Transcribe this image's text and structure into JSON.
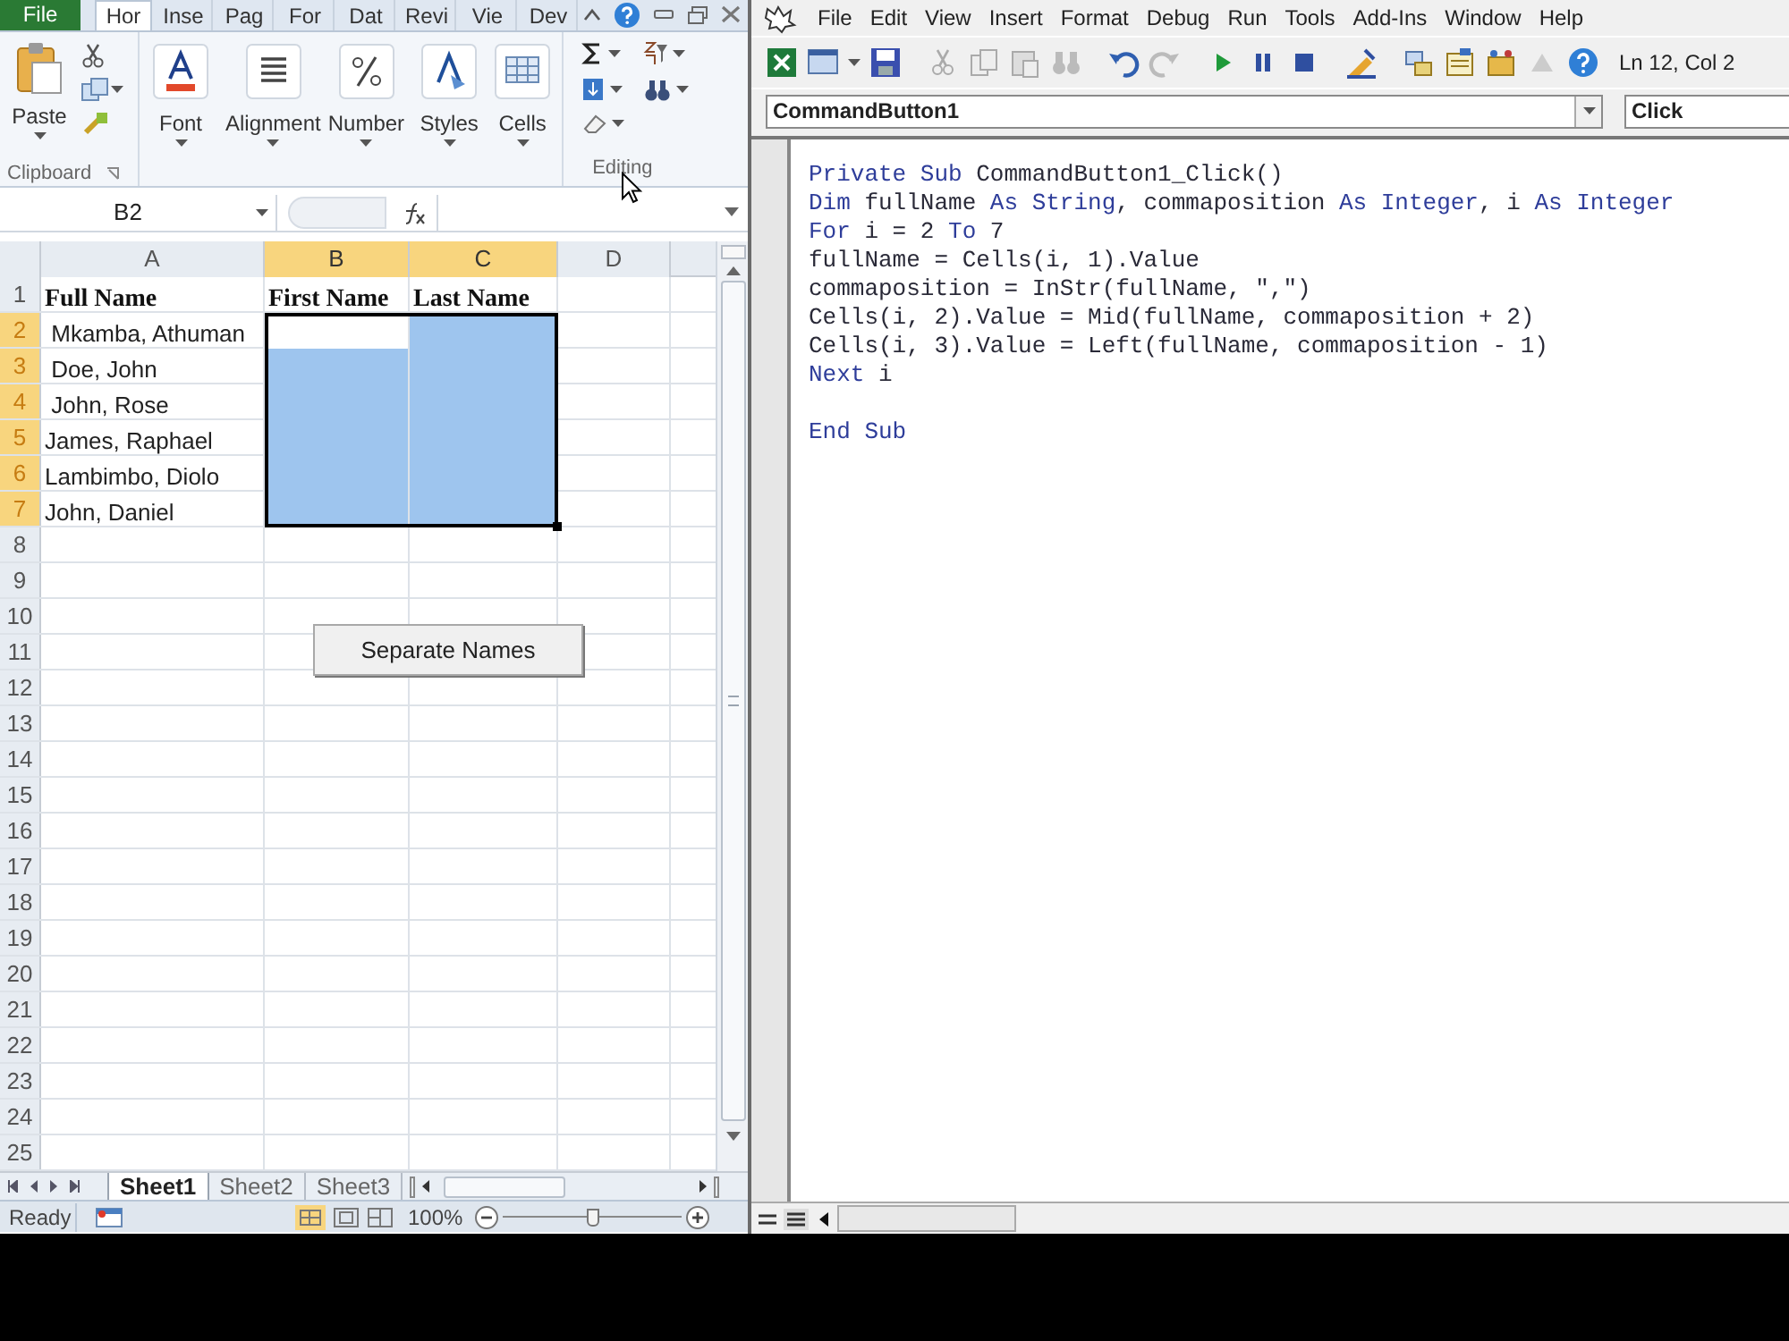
{
  "excel": {
    "file_tab": "File",
    "ribbon_tabs": [
      {
        "label": "Hor",
        "selected": true
      },
      {
        "label": "Inse",
        "selected": false
      },
      {
        "label": "Pag",
        "selected": false
      },
      {
        "label": "For",
        "selected": false
      },
      {
        "label": "Dat",
        "selected": false
      },
      {
        "label": "Revi",
        "selected": false
      },
      {
        "label": "Vie",
        "selected": false
      },
      {
        "label": "Dev",
        "selected": false
      }
    ],
    "ribbon": {
      "paste": "Paste",
      "clipboard_group": "Clipboard",
      "commands": [
        "Font",
        "Alignment",
        "Number",
        "Styles",
        "Cells"
      ],
      "editing_group": "Editing"
    },
    "name_box": "B2",
    "columns": [
      {
        "label": "A",
        "selected": false
      },
      {
        "label": "B",
        "selected": true
      },
      {
        "label": "C",
        "selected": true
      },
      {
        "label": "D",
        "selected": false
      }
    ],
    "header_row": {
      "number": "1",
      "cells": [
        "Full Name",
        "First Name",
        "Last Name"
      ]
    },
    "rows": [
      {
        "number": "2",
        "selected": true,
        "active": true,
        "full_name": " Mkamba, Athuman"
      },
      {
        "number": "3",
        "selected": true,
        "active": false,
        "full_name": " Doe, John"
      },
      {
        "number": "4",
        "selected": true,
        "active": false,
        "full_name": " John, Rose"
      },
      {
        "number": "5",
        "selected": true,
        "active": false,
        "full_name": "James, Raphael"
      },
      {
        "number": "6",
        "selected": true,
        "active": false,
        "full_name": "Lambimbo, Diolo"
      },
      {
        "number": "7",
        "selected": true,
        "active": false,
        "full_name": "John, Daniel"
      },
      {
        "number": "8",
        "selected": false
      },
      {
        "number": "9",
        "selected": false
      },
      {
        "number": "10",
        "selected": false
      },
      {
        "number": "11",
        "selected": false
      },
      {
        "number": "12",
        "selected": false
      },
      {
        "number": "13",
        "selected": false
      },
      {
        "number": "14",
        "selected": false
      },
      {
        "number": "15",
        "selected": false
      },
      {
        "number": "16",
        "selected": false
      },
      {
        "number": "17",
        "selected": false
      },
      {
        "number": "18",
        "selected": false
      },
      {
        "number": "19",
        "selected": false
      },
      {
        "number": "20",
        "selected": false
      },
      {
        "number": "21",
        "selected": false
      },
      {
        "number": "22",
        "selected": false
      },
      {
        "number": "23",
        "selected": false
      },
      {
        "number": "24",
        "selected": false
      },
      {
        "number": "25",
        "selected": false
      }
    ],
    "button": "Separate Names",
    "sheet_tabs": [
      {
        "label": "Sheet1",
        "selected": true
      },
      {
        "label": "Sheet2",
        "selected": false
      },
      {
        "label": "Sheet3",
        "selected": false
      }
    ],
    "status": "Ready",
    "zoom": "100%",
    "zoom_slider": {
      "level": 0.5
    }
  },
  "vba": {
    "menu": [
      "File",
      "Edit",
      "View",
      "Insert",
      "Format",
      "Debug",
      "Run",
      "Tools",
      "Add-Ins",
      "Window",
      "Help"
    ],
    "cursor_position": "Ln 12, Col 2",
    "object_box": "CommandButton1",
    "procedure_box": "Click",
    "code": [
      {
        "kind": "code",
        "segments": [
          {
            "kind": "keyword",
            "text": "Private Sub"
          },
          {
            "kind": "plain",
            "text": " CommandButton1_Click()"
          }
        ]
      },
      {
        "kind": "code",
        "segments": [
          {
            "kind": "keyword",
            "text": "Dim"
          },
          {
            "kind": "plain",
            "text": " fullName "
          },
          {
            "kind": "keyword",
            "text": "As String"
          },
          {
            "kind": "plain",
            "text": ", commaposition "
          },
          {
            "kind": "keyword",
            "text": "As Integer"
          },
          {
            "kind": "plain",
            "text": ", i "
          },
          {
            "kind": "keyword",
            "text": "As Integer"
          }
        ]
      },
      {
        "kind": "code",
        "segments": [
          {
            "kind": "keyword",
            "text": "For"
          },
          {
            "kind": "plain",
            "text": " i = 2 "
          },
          {
            "kind": "keyword",
            "text": "To"
          },
          {
            "kind": "plain",
            "text": " 7"
          }
        ]
      },
      {
        "kind": "code",
        "segments": [
          {
            "kind": "plain",
            "text": "fullName = Cells(i, 1).Value"
          }
        ]
      },
      {
        "kind": "code",
        "segments": [
          {
            "kind": "plain",
            "text": "commaposition = InStr(fullName, \",\")"
          }
        ]
      },
      {
        "kind": "code",
        "segments": [
          {
            "kind": "plain",
            "text": "Cells(i, 2).Value = Mid(fullName, commaposition + 2)"
          }
        ]
      },
      {
        "kind": "code",
        "segments": [
          {
            "kind": "plain",
            "text": "Cells(i, 3).Value = Left(fullName, commaposition - 1)"
          }
        ]
      },
      {
        "kind": "code",
        "segments": [
          {
            "kind": "keyword",
            "text": "Next"
          },
          {
            "kind": "plain",
            "text": " i"
          }
        ]
      },
      {
        "kind": "blank"
      },
      {
        "kind": "code",
        "segments": [
          {
            "kind": "keyword",
            "text": "End Sub"
          }
        ]
      }
    ]
  }
}
